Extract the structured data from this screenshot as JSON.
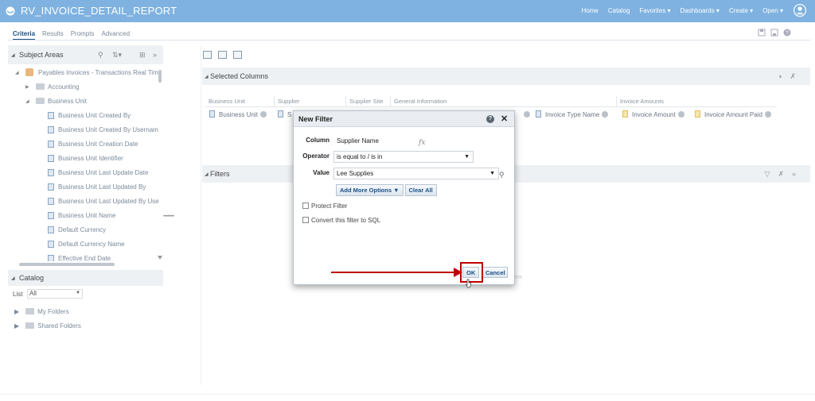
{
  "app": {
    "title": "RV_INVOICE_DETAIL_REPORT",
    "nav": [
      "Home",
      "Catalog",
      "Favorites ▾",
      "Dashboards ▾",
      "Create ▾",
      "Open ▾"
    ]
  },
  "tabs": [
    {
      "label": "Criteria",
      "active": true
    },
    {
      "label": "Results",
      "active": false
    },
    {
      "label": "Prompts",
      "active": false
    },
    {
      "label": "Advanced",
      "active": false
    }
  ],
  "subject_areas": {
    "title": "Subject Areas",
    "root": "Payables Invoices - Transactions Real Tim",
    "folders": [
      "Accounting",
      "Business Unit"
    ],
    "columns": [
      "Business Unit Created By",
      "Business Unit Created By Usernam",
      "Business Unit Creation Date",
      "Business Unit Identifier",
      "Business Unit Last Update Date",
      "Business Unit Last Updated By",
      "Business Unit Last Updated By Use",
      "Business Unit Name",
      "Default Currency",
      "Default Currency Name",
      "Effective End Date"
    ]
  },
  "catalog": {
    "title": "Catalog",
    "list_label": "List",
    "list_value": "All",
    "folders": [
      "My Folders",
      "Shared Folders"
    ]
  },
  "selected_columns": {
    "title": "Selected Columns",
    "groups": [
      "Business Unit",
      "Supplier",
      "Supplier Site",
      "General Information",
      "Invoice Amounts"
    ],
    "columns": [
      "Business Unit",
      "S",
      "Invoice Type Name",
      "Invoice Amount",
      "Invoice Amount Paid"
    ]
  },
  "filters": {
    "title": "Filters"
  },
  "dialog": {
    "title": "New Filter",
    "column_label": "Column",
    "column_value": "Supplier Name",
    "operator_label": "Operator",
    "operator_value": "is equal to / is in",
    "value_label": "Value",
    "value_value": "Lee Supplies",
    "add_more_options": "Add More Options ▼",
    "clear_all": "Clear All",
    "protect_filter": "Protect Filter",
    "convert_sql": "Convert this filter to SQL",
    "ok": "OK",
    "cancel": "Cancel",
    "fx": "fx",
    "help": "?",
    "close": "✕"
  },
  "colors": {
    "topbar": "#7fb2e0",
    "link": "#1a4f86",
    "highlight": "#c00000"
  }
}
